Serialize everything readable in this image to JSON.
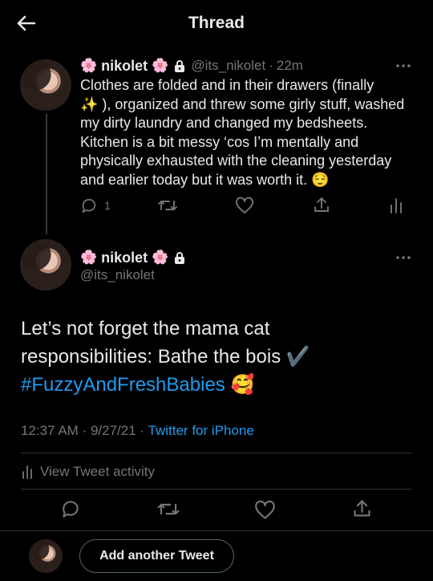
{
  "header": {
    "title": "Thread"
  },
  "icons": {
    "back": "arrow-left-icon",
    "more": "more-dots-icon",
    "lock": "lock-icon",
    "flower": "cherry-blossom-emoji",
    "reply": "reply-icon",
    "retweet": "retweet-icon",
    "like": "heart-icon",
    "share": "share-icon",
    "analytics": "analytics-icon"
  },
  "colors": {
    "accent": "#1d9bf0",
    "muted": "#71767b",
    "text": "#e7e9ea",
    "background": "#000000"
  },
  "tweet1": {
    "flower_left": "🌸",
    "name": "nikolet",
    "flower_right": "🌸",
    "handle": "@its_nikolet",
    "separator": "·",
    "time": "22m",
    "lines": [
      "Clothes are folded and in their drawers (finally",
      "✨ ), organized and threw some girly stuff, washed",
      "my dirty laundry and changed my bedsheets.",
      "Kitchen is a bit messy ‘cos I’m mentally and",
      "physically exhausted with the cleaning yesterday",
      "and earlier today but it was worth it. 😌"
    ],
    "reply_count": "1"
  },
  "tweet2": {
    "flower_left": "🌸",
    "name": "nikolet",
    "flower_right": "🌸",
    "handle": "@its_nikolet",
    "line1": "Let’s not forget the mama cat",
    "line2": "responsibilities: Bathe the bois ✔️",
    "hashtag": "#FuzzyAndFreshBabies",
    "hashtag_emoji": "🥰",
    "time": "12:37 AM",
    "dot1": "·",
    "date": "9/27/21",
    "dot2": "·",
    "source": "Twitter for iPhone",
    "activity_label": "View Tweet activity"
  },
  "composer": {
    "button_label": "Add another Tweet"
  }
}
